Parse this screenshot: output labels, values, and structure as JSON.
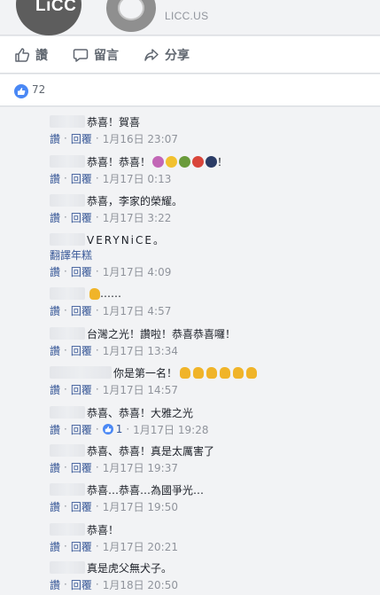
{
  "link_preview": {
    "logo_text": "LiCC",
    "domain": "LICC.US"
  },
  "actions": {
    "like": "讚",
    "comment": "留言",
    "share": "分享"
  },
  "reactions": {
    "count": "72"
  },
  "colors": {
    "link": "#385898",
    "like_blue": "#4a88f5",
    "meta_gray": "#90949c"
  },
  "labels": {
    "like": "讚",
    "reply": "回覆",
    "translate": "翻譯年糕"
  },
  "comments": [
    {
      "text": "恭喜！賀喜",
      "time": "1月16日 23:07"
    },
    {
      "text": "恭喜！恭喜！",
      "suffix": "！",
      "time": "1月17日 0:13"
    },
    {
      "text": "恭喜，李家的榮耀。",
      "time": "1月17日 3:22"
    },
    {
      "text": "VERYNiCE。",
      "time": "1月17日 4:09"
    },
    {
      "text": "……",
      "time": "1月17日 4:57"
    },
    {
      "text": "台灣之光！讚啦！恭喜恭喜囉！",
      "time": "1月17日 13:34"
    },
    {
      "text": "你是第一名！",
      "time": "1月17日 14:57"
    },
    {
      "text": "恭喜、恭喜！大雅之光",
      "likes": "1",
      "time": "1月17日 19:28"
    },
    {
      "text": "恭喜、恭喜！真是太厲害了",
      "time": "1月17日 19:37"
    },
    {
      "text": "恭喜…恭喜…為國爭光…",
      "time": "1月17日 19:50"
    },
    {
      "text": "恭喜！",
      "time": "1月17日 20:21"
    },
    {
      "text": "真是虎父無犬子。",
      "time": "1月18日 20:50"
    }
  ]
}
